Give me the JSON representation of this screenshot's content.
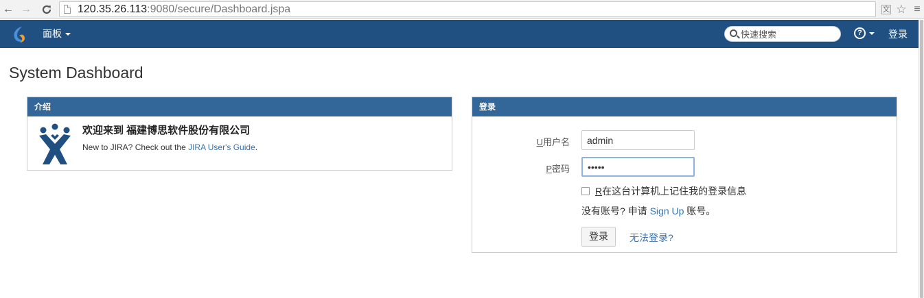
{
  "browser": {
    "nav_back": "←",
    "nav_forward": "→",
    "nav_reload": "C",
    "url_host": "120.35.26.113",
    "url_rest": ":9080/secure/Dashboard.jspa",
    "icons": [
      "page-icon",
      "translate-icon",
      "star-icon",
      "menu-icon"
    ]
  },
  "header": {
    "dashboards_label": "面板",
    "search_placeholder": "快速搜索",
    "help_glyph": "?",
    "login_label": "登录",
    "colors": {
      "bar": "#205081",
      "text": "#ffffff"
    }
  },
  "page": {
    "title": "System Dashboard"
  },
  "intro_gadget": {
    "heading": "介绍",
    "welcome": "欢迎来到 福建博思软件股份有限公司",
    "text_before": "New to JIRA? Check out the ",
    "link": "JIRA User's Guide",
    "text_after": "."
  },
  "login_gadget": {
    "heading": "登录",
    "username_key": "U",
    "username_label": "用户名",
    "username_value": "admin",
    "password_key": "P",
    "password_label": "密码",
    "password_value": "•••••",
    "remember_key": "R",
    "remember_label": "在这台计算机上记住我的登录信息",
    "signup_before": "没有账号? 申请 ",
    "signup_link": "Sign Up",
    "signup_after": " 账号。",
    "login_button": "登录",
    "forgot_link": "无法登录?"
  },
  "colors": {
    "gadget_header": "#336699",
    "link": "#3b73af"
  }
}
